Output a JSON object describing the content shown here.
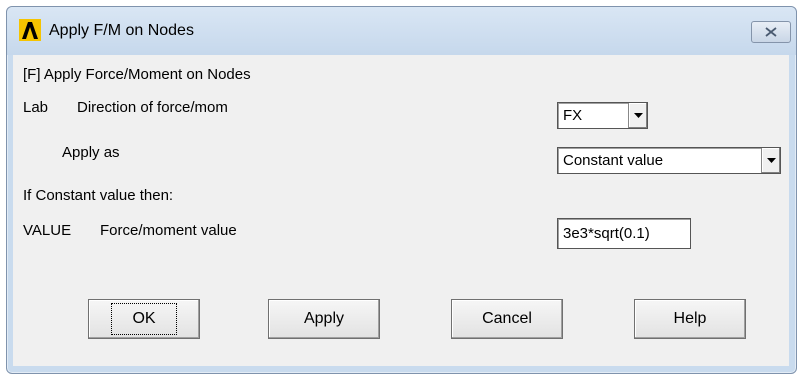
{
  "window": {
    "title": "Apply F/M on Nodes",
    "close_icon": "close-icon"
  },
  "form": {
    "heading": "[F]  Apply Force/Moment on Nodes",
    "lab_key": "Lab",
    "lab_desc": "Direction of force/mom",
    "lab_value": "FX",
    "apply_as_label": "Apply as",
    "apply_as_value": "Constant value",
    "if_constant_label": "If Constant value then:",
    "value_key": "VALUE",
    "value_desc": "Force/moment value",
    "value_input": "3e3*sqrt(0.1)"
  },
  "buttons": {
    "ok": "OK",
    "apply": "Apply",
    "cancel": "Cancel",
    "help": "Help"
  }
}
